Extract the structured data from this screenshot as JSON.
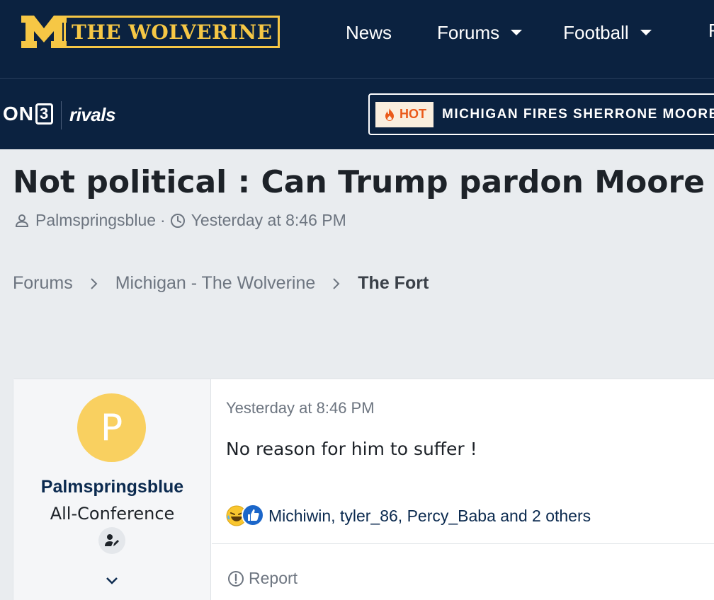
{
  "header": {
    "logo_text": "THE WOLVERINE",
    "nav": [
      {
        "label": "News"
      },
      {
        "label": "Forums"
      },
      {
        "label": "Football"
      }
    ],
    "nav_partial": "F",
    "brand_primary": "#0b2240",
    "brand_accent": "#f6c745"
  },
  "subheader": {
    "on3_label": "ON",
    "on3_box": "3",
    "rivals_label": "rivals",
    "hot_label": "HOT",
    "ticker_text": "MICHIGAN FIRES SHERRONE MOORE"
  },
  "thread": {
    "title": "Not political : Can Trump pardon Moore ?",
    "author": "Palmspringsblue",
    "meta_sep": "·",
    "date": "Yesterday at 8:46 PM"
  },
  "breadcrumb": [
    {
      "label": "Forums"
    },
    {
      "label": "Michigan - The Wolverine"
    },
    {
      "label": "The Fort"
    }
  ],
  "post": {
    "avatar_letter": "P",
    "username": "Palmspringsblue",
    "user_title": "All-Conference",
    "date": "Yesterday at 8:46 PM",
    "body": "No reason for him to suffer !",
    "reactions_text": "Michiwin, tyler_86, Percy_Baba and 2 others",
    "report_label": "Report",
    "icons": [
      "laughing-emoji-icon",
      "like-icon",
      "user-badge-icon",
      "chevron-down-icon",
      "report-icon"
    ]
  }
}
